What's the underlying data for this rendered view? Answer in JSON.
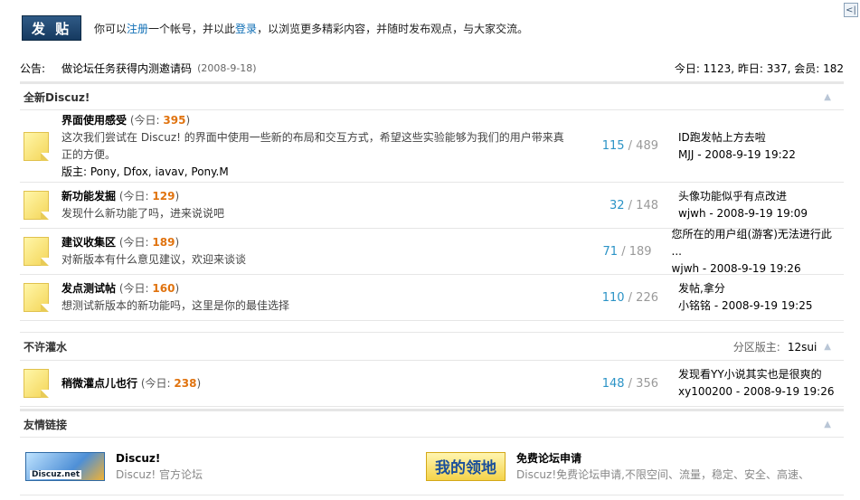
{
  "topbar": {
    "post_button": "发 贴",
    "welcome_pre": "你可以",
    "register_link": "注册",
    "welcome_mid": "一个帐号，并以此",
    "login_link": "登录",
    "welcome_post": "，以浏览更多精彩内容，并随时发布观点，与大家交流。"
  },
  "notice": {
    "label": "公告:",
    "text": "做论坛任务获得内测邀请码",
    "date": "(2008-9-18)",
    "stats": "今日: 1123, 昨日: 337, 会员: 182"
  },
  "categories": [
    {
      "title": "全新Discuz!",
      "forums": [
        {
          "name": "界面使用感受",
          "today_label": "(今日: ",
          "today": "395",
          "today_close": ")",
          "desc": "这次我们尝试在 Discuz! 的界面中使用一些新的布局和交互方式，希望这些实验能够为我们的用户带来真正的方便。",
          "moderators": "版主: Pony, Dfox, iavav, Pony.M",
          "threads": "115",
          "posts": "/ 489",
          "last_title": "ID跑发帖上方去啦",
          "last_by": "MJJ - 2008-9-19 19:22"
        },
        {
          "name": "新功能发掘",
          "today_label": "(今日: ",
          "today": "129",
          "today_close": ")",
          "desc": "发现什么新功能了吗，进来说说吧",
          "threads": "32",
          "posts": "/ 148",
          "last_title": "头像功能似乎有点改进",
          "last_by": "wjwh - 2008-9-19 19:09"
        },
        {
          "name": "建议收集区",
          "today_label": "(今日: ",
          "today": "189",
          "today_close": ")",
          "desc": "对新版本有什么意见建议，欢迎来谈谈",
          "threads": "71",
          "posts": "/ 189",
          "last_title": "您所在的用户组(游客)无法进行此 ...",
          "last_by": "wjwh - 2008-9-19 19:26"
        },
        {
          "name": "发点测试帖",
          "today_label": "(今日: ",
          "today": "160",
          "today_close": ")",
          "desc": "想测试新版本的新功能吗，这里是你的最佳选择",
          "threads": "110",
          "posts": "/ 226",
          "last_title": "发帖,拿分",
          "last_by": "小铭铭 - 2008-9-19 19:25"
        }
      ]
    },
    {
      "title": "不许灌水",
      "moderator_label": "分区版主:",
      "moderator": "12sui",
      "forums": [
        {
          "name": "稍微灌点儿也行",
          "today_label": "(今日: ",
          "today": "238",
          "today_close": ")",
          "threads": "148",
          "posts": "/ 356",
          "last_title": "发现看YY小说其实也是很爽的",
          "last_by": "xy100200 - 2008-9-19 19:26"
        }
      ]
    }
  ],
  "links": {
    "title": "友情链接",
    "items": [
      {
        "logo_text": "Discuz.net",
        "name": "Discuz!",
        "desc": "Discuz! 官方论坛"
      },
      {
        "logo_text": "我的领地",
        "name": "免费论坛申请",
        "desc": "Discuz!免费论坛申请,不限空间、流量，稳定、安全、高速、"
      }
    ]
  },
  "icons": {
    "collapse": "chevron-up-icon",
    "side_toggle": "collapse-sidebar-icon"
  },
  "colors": {
    "accent_link": "#0e6eb5",
    "today_count": "#e0730f",
    "thread_count": "#2b93c6"
  }
}
